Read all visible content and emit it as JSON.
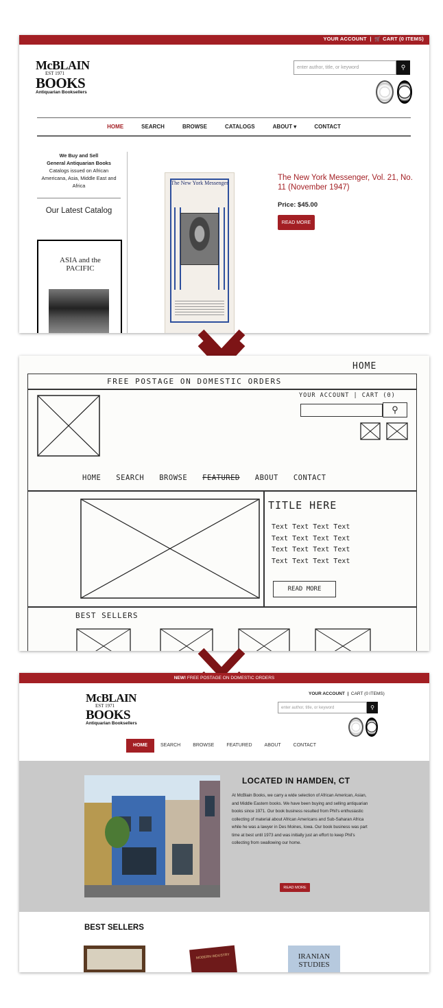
{
  "panel1": {
    "topbar": {
      "account": "YOUR ACCOUNT",
      "sep": "|",
      "cart": "🛒 CART (0 ITEMS)"
    },
    "logo": {
      "line1": "McBLAIN",
      "line2": "EST 1971",
      "line3": "BOOKS",
      "line4": "Antiquarian Booksellers"
    },
    "search": {
      "placeholder": "enter author, title, or keyword"
    },
    "nav": [
      "HOME",
      "SEARCH",
      "BROWSE",
      "CATALOGS",
      "ABOUT ▾",
      "CONTACT"
    ],
    "sidebar": {
      "intro_bold1": "We Buy and Sell",
      "intro_bold2": "General Antiquarian Books",
      "intro_text": "Catalogs issued on African Americana, Asia, Middle East and Africa",
      "catalog_heading": "Our Latest Catalog",
      "catalog_title": "ASIA and the PACIFIC"
    },
    "product": {
      "magazine_title": "The New York Messenger",
      "title": "The New York Messenger, Vol. 21, No. 11 (November 1947)",
      "price": "Price: $45.00",
      "button": "READ MORE"
    }
  },
  "panel2": {
    "page_label": "HOME",
    "banner": "FREE POSTAGE ON DOMESTIC ORDERS",
    "account": "YOUR ACCOUNT | CART (0)",
    "nav": [
      "HOME",
      "SEARCH",
      "BROWSE",
      "FEATURED",
      "ABOUT",
      "CONTACT"
    ],
    "title": "TITLE HERE",
    "text_lines": [
      "Text Text Text Text",
      "Text Text Text Text",
      "Text Text Text Text",
      "Text Text Text Text"
    ],
    "button": "READ MORE",
    "best_sellers": "BEST SELLERS"
  },
  "panel3": {
    "banner_new": "NEW!",
    "banner_text": "FREE POSTAGE ON DOMESTIC ORDERS",
    "account": "YOUR ACCOUNT",
    "cart": "CART (0 ITEMS)",
    "logo": {
      "line1": "McBLAIN",
      "line2": "EST 1971",
      "line3": "BOOKS",
      "line4": "Antiquarian Booksellers"
    },
    "search": {
      "placeholder": "enter author, title, or keyword"
    },
    "nav": [
      "HOME",
      "SEARCH",
      "BROWSE",
      "FEATURED",
      "ABOUT",
      "CONTACT"
    ],
    "hero": {
      "title": "LOCATED IN HAMDEN, CT",
      "text": "At McBlain Books, we carry a wide selection of African American, Asian, and Middle Eastern books. We have been buying and selling antiquarian books since 1971. Our book business resulted from Phil's enthusiastic collecting of material about African Americans and Sub-Saharan Africa while he was a lawyer in Des Moines, Iowa. Our book business was part time at best until 1973 and was initially just an effort to keep Phil's collecting from swallowing our home.",
      "button": "READ MORE"
    },
    "best_sellers": "BEST SELLERS",
    "books": [
      "MODERN INDUSTRY",
      "IRANIAN STUDIES"
    ]
  },
  "colors": {
    "brand": "#a31f24",
    "arrow": "#7d1416",
    "hero_bg": "#c9c9c9"
  }
}
